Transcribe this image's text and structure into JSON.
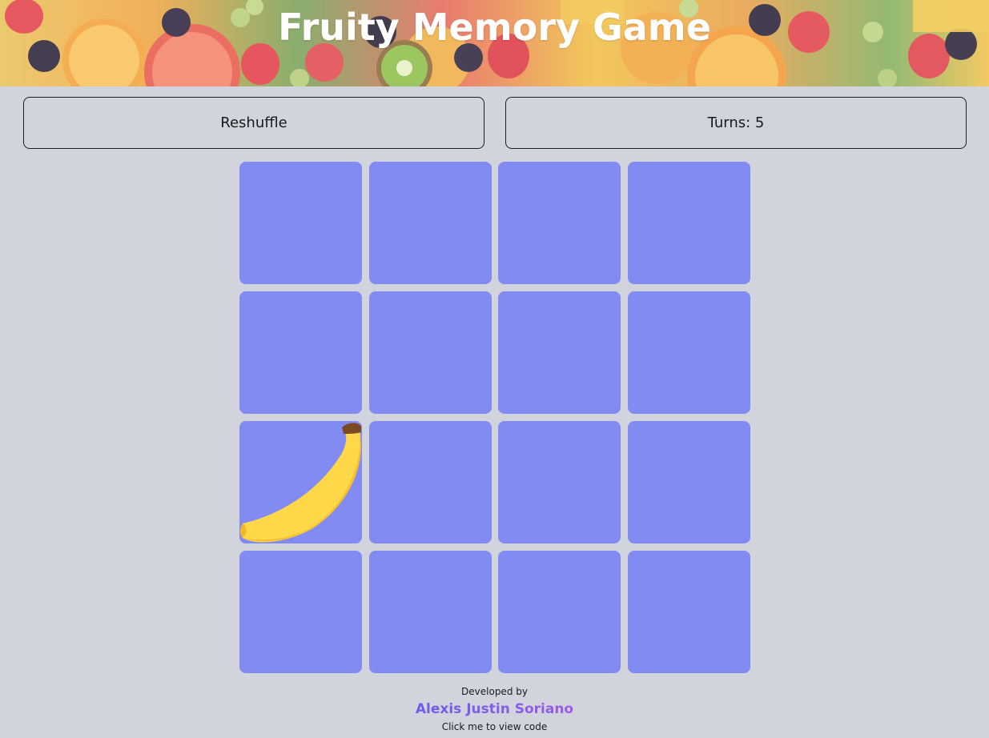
{
  "header": {
    "title": "Fruity Memory Game"
  },
  "controls": {
    "reshuffle_label": "Reshuffle",
    "turns_label": "Turns: 5"
  },
  "board": {
    "rows": 4,
    "columns": 4,
    "card_back_color": "#828bf2",
    "revealed_card": {
      "row": 3,
      "column": 1,
      "fruit": "banana-icon"
    }
  },
  "footer": {
    "developed_by": "Developed by",
    "developer_name": "Alexis Justin Soriano",
    "view_code_hint": "Click me to view code"
  },
  "colors": {
    "background": "#d1d4dc",
    "title": "#ffffff",
    "name_gradient_start": "#6a5cf0",
    "name_gradient_end": "#9b5ae8"
  }
}
